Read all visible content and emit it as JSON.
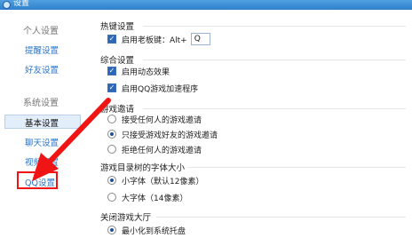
{
  "window": {
    "title": "设置"
  },
  "sidebar": {
    "group_personal": "个人设置",
    "item_reminder": "提醒设置",
    "item_friends": "好友设置",
    "group_system": "系统设置",
    "item_basic": "基本设置",
    "item_chat": "聊天设置",
    "item_video": "视频设置",
    "item_qq": "QQ设置"
  },
  "main": {
    "hotkey": {
      "title": "热键设置",
      "boss_key_label": "启用老板键：Alt+",
      "boss_key_value": "Q",
      "boss_key_checked": true
    },
    "general": {
      "title": "综合设置",
      "dynamic_effects_label": "启用动态效果",
      "qq_accel_label": "启用QQ游戏加速程序"
    },
    "invite": {
      "title": "游戏邀请",
      "option_all": "接受任何人的游戏邀请",
      "option_friends": "只接受游戏好友的游戏邀请",
      "option_reject": "拒绝任何人的游戏邀请",
      "selected": "option_friends"
    },
    "font_size": {
      "title": "游戏目录树的字体大小",
      "small": "小字体（默认12像素）",
      "large": "大字体（14像素）",
      "selected": "small"
    },
    "close_hall": {
      "title": "关闭游戏大厅",
      "minimize": "最小化到系统托盘"
    }
  },
  "colors": {
    "titlebar": "#2f7fcc",
    "link": "#2d74c4",
    "arrow": "#f01414",
    "selected_bg": "#e3eefb"
  },
  "icons": {
    "app": "qq-game-icon",
    "check": "check-icon"
  }
}
